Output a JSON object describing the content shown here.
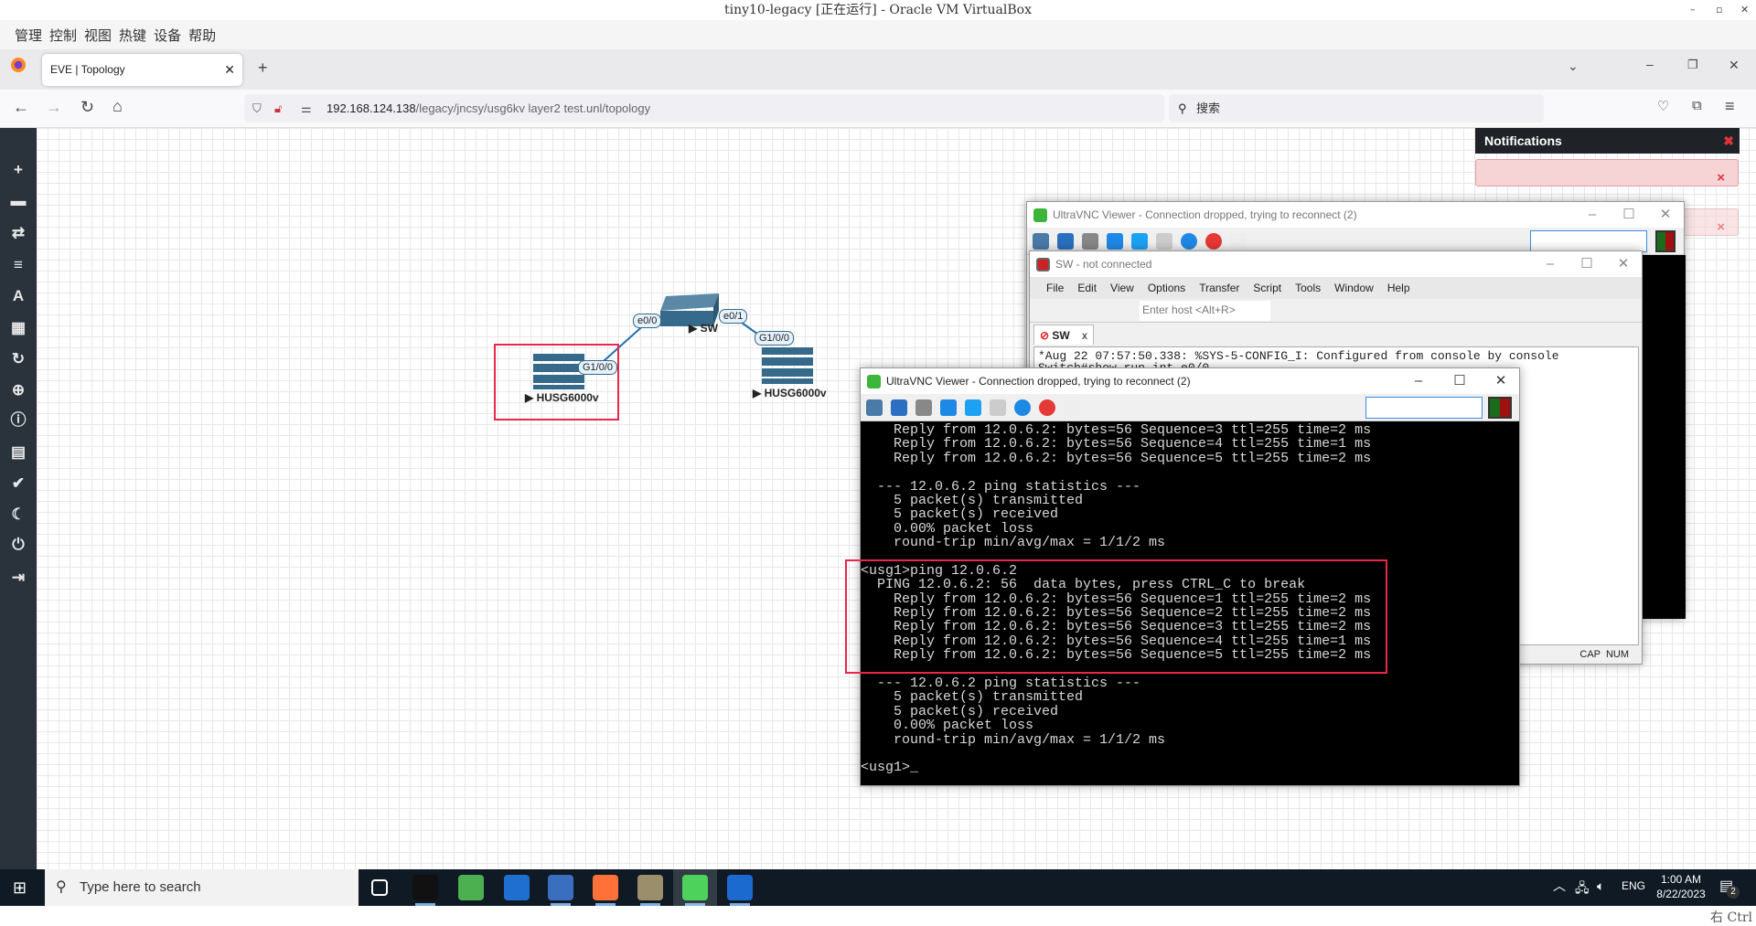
{
  "vbox": {
    "title": "tiny10-legacy [正在运行] - Oracle VM VirtualBox",
    "menu": [
      "管理",
      "控制",
      "视图",
      "热键",
      "设备",
      "帮助"
    ],
    "host_key": "右 Ctrl"
  },
  "browser": {
    "tab_title": "EVE | Topology",
    "url_host": "192.168.124.138",
    "url_path": "/legacy/jncsy/usg6kv layer2 test.unl/topology",
    "search_placeholder": "搜索"
  },
  "eve": {
    "sidebar_icons": [
      "add-icon",
      "nodes-icon",
      "networks-icon",
      "startup-configs-icon",
      "text-icon",
      "grid-icon",
      "refresh-icon",
      "zoom-icon",
      "info-icon",
      "notes-icon",
      "status-icon",
      "dark-mode-icon",
      "power-icon",
      "logout-icon"
    ],
    "notifications_title": "Notifications",
    "nodes": [
      {
        "name": "SW"
      },
      {
        "name": "HUSG6000v"
      },
      {
        "name": "HUSG6000v"
      }
    ],
    "ports": [
      "e0/0",
      "e0/1",
      "G1/0/0",
      "G1/0/0"
    ]
  },
  "vnc_back": {
    "title": "UltraVNC Viewer - Connection dropped, trying to reconnect (2)"
  },
  "securecrt": {
    "title": "SW - not connected",
    "menu": [
      "File",
      "Edit",
      "View",
      "Options",
      "Transfer",
      "Script",
      "Tools",
      "Window",
      "Help"
    ],
    "host_placeholder": "Enter host <Alt+R>",
    "tab": "SW",
    "lines": [
      "*Aug 22 07:57:50.338: %SYS-5-CONFIG_I: Configured from console by console",
      "Switch#show run int e0/0"
    ],
    "status": [
      "CAP",
      "NUM"
    ]
  },
  "vnc_front": {
    "title": "UltraVNC Viewer - Connection dropped, trying to reconnect (2)",
    "lines": [
      "    Reply from 12.0.6.2: bytes=56 Sequence=3 ttl=255 time=2 ms",
      "    Reply from 12.0.6.2: bytes=56 Sequence=4 ttl=255 time=1 ms",
      "    Reply from 12.0.6.2: bytes=56 Sequence=5 ttl=255 time=2 ms",
      "",
      "  --- 12.0.6.2 ping statistics ---",
      "    5 packet(s) transmitted",
      "    5 packet(s) received",
      "    0.00% packet loss",
      "    round-trip min/avg/max = 1/1/2 ms",
      "",
      "<usg1>ping 12.0.6.2",
      "  PING 12.0.6.2: 56  data bytes, press CTRL_C to break",
      "    Reply from 12.0.6.2: bytes=56 Sequence=1 ttl=255 time=2 ms",
      "    Reply from 12.0.6.2: bytes=56 Sequence=2 ttl=255 time=2 ms",
      "    Reply from 12.0.6.2: bytes=56 Sequence=3 ttl=255 time=2 ms",
      "    Reply from 12.0.6.2: bytes=56 Sequence=4 ttl=255 time=1 ms",
      "    Reply from 12.0.6.2: bytes=56 Sequence=5 ttl=255 time=2 ms",
      "",
      "  --- 12.0.6.2 ping statistics ---",
      "    5 packet(s) transmitted",
      "    5 packet(s) received",
      "    0.00% packet loss",
      "    round-trip min/avg/max = 1/1/2 ms",
      "",
      "<usg1>_"
    ]
  },
  "taskbar": {
    "search_placeholder": "Type here to search",
    "time": "1:00 AM",
    "date": "8/22/2023",
    "lang": "ENG",
    "notification_count": "2",
    "apps": [
      "task-view-icon",
      "terminal-icon",
      "browser-icon",
      "bolt-app-icon",
      "network-app-icon",
      "firefox-icon",
      "securecrt-icon",
      "ultravnc-icon",
      "wireshark-icon"
    ]
  },
  "colors": {
    "highlight": "#e8284a",
    "node": "#356a8a",
    "sidebar": "#2a323c"
  }
}
